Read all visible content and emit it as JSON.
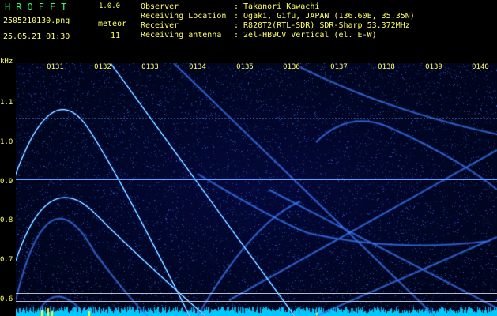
{
  "app": {
    "logo": "HROFFT",
    "version": "1.0.0"
  },
  "file": {
    "name": "2505210130.png",
    "timestamp": "25.05.21 01:30"
  },
  "meteor": {
    "label": "meteor",
    "count": "11"
  },
  "info": [
    {
      "key": "Observer",
      "value": ": Takanori Kawachi"
    },
    {
      "key": "Receiving Location",
      "value": ": Ogaki, Gifu, JAPAN (136.60E, 35.35N)"
    },
    {
      "key": "Receiver",
      "value": ": R820T2(RTL-SDR) SDR-Sharp 53.372MHz"
    },
    {
      "key": "Receiving antenna",
      "value": ": 2el-HB9CV Vertical (el. E-W)"
    }
  ],
  "axis": {
    "unit": "kHz",
    "y_ticks": [
      "1.1",
      "1.0",
      "0.9",
      "0.8",
      "0.7",
      "0.6"
    ],
    "x_ticks": [
      "0131",
      "0132",
      "0133",
      "0134",
      "0135",
      "0136",
      "0137",
      "0138",
      "0139",
      "0140"
    ]
  },
  "colors": {
    "text": "#ffff66",
    "logo": "#33ff66",
    "signal": "#3a7bff",
    "bright": "#7fd8ff",
    "floor": "#00c8ff"
  }
}
